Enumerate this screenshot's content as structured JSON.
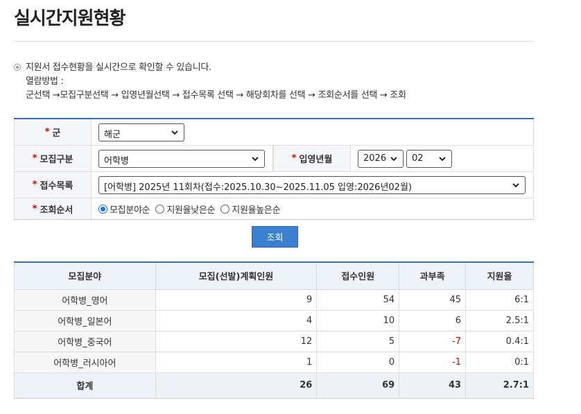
{
  "page": {
    "title": "실시간지원현황"
  },
  "guide": {
    "line1": "지원서 접수현황을 실시간으로 확인할 수 있습니다.",
    "line2": "열람방법 :",
    "line3": "군선택 →모집구분선택 → 입영년월선택 → 접수목록 선택 → 해당회차를 선택 → 조회순서를 선택 → 조회"
  },
  "form": {
    "required_mark": "*",
    "military_label": "군",
    "military_value": "해군",
    "category_label": "모집구분",
    "category_value": "어학병",
    "enlist_label": "입영년월",
    "enlist_year": "2026",
    "enlist_month": "02",
    "reception_label": "접수목록",
    "reception_value": "[어학병] 2025년 11회차(접수:2025.10.30~2025.11.05 입영:2026년02월)",
    "order_label": "조회순서",
    "order_options": [
      "모집분야순",
      "지원율낮은순",
      "지원율높은순"
    ],
    "order_selected": 0,
    "search_button": "조회"
  },
  "results": {
    "headers": [
      "모집분야",
      "모집(선발)계획인원",
      "접수인원",
      "과부족",
      "지원율"
    ],
    "rows": [
      {
        "name": "어학병_영어",
        "plan": "9",
        "applied": "54",
        "diff": "45",
        "rate": "6:1",
        "negative": false
      },
      {
        "name": "어학병_일본어",
        "plan": "4",
        "applied": "10",
        "diff": "6",
        "rate": "2.5:1",
        "negative": false
      },
      {
        "name": "어학병_중국어",
        "plan": "12",
        "applied": "5",
        "diff": "-7",
        "rate": "0.4:1",
        "negative": true
      },
      {
        "name": "어학병_러시아어",
        "plan": "1",
        "applied": "0",
        "diff": "-1",
        "rate": "0:1",
        "negative": true
      }
    ],
    "total": {
      "name": "합계",
      "plan": "26",
      "applied": "69",
      "diff": "43",
      "rate": "2.7:1"
    }
  },
  "colors": {
    "accent_blue": "#3a6fb5",
    "button_blue": "#3a7fd0",
    "negative_red": "#e00000",
    "required_red": "#d60000"
  },
  "icons": {
    "bullet": "circle-bullet-icon",
    "select": "chevron-down-icon"
  }
}
